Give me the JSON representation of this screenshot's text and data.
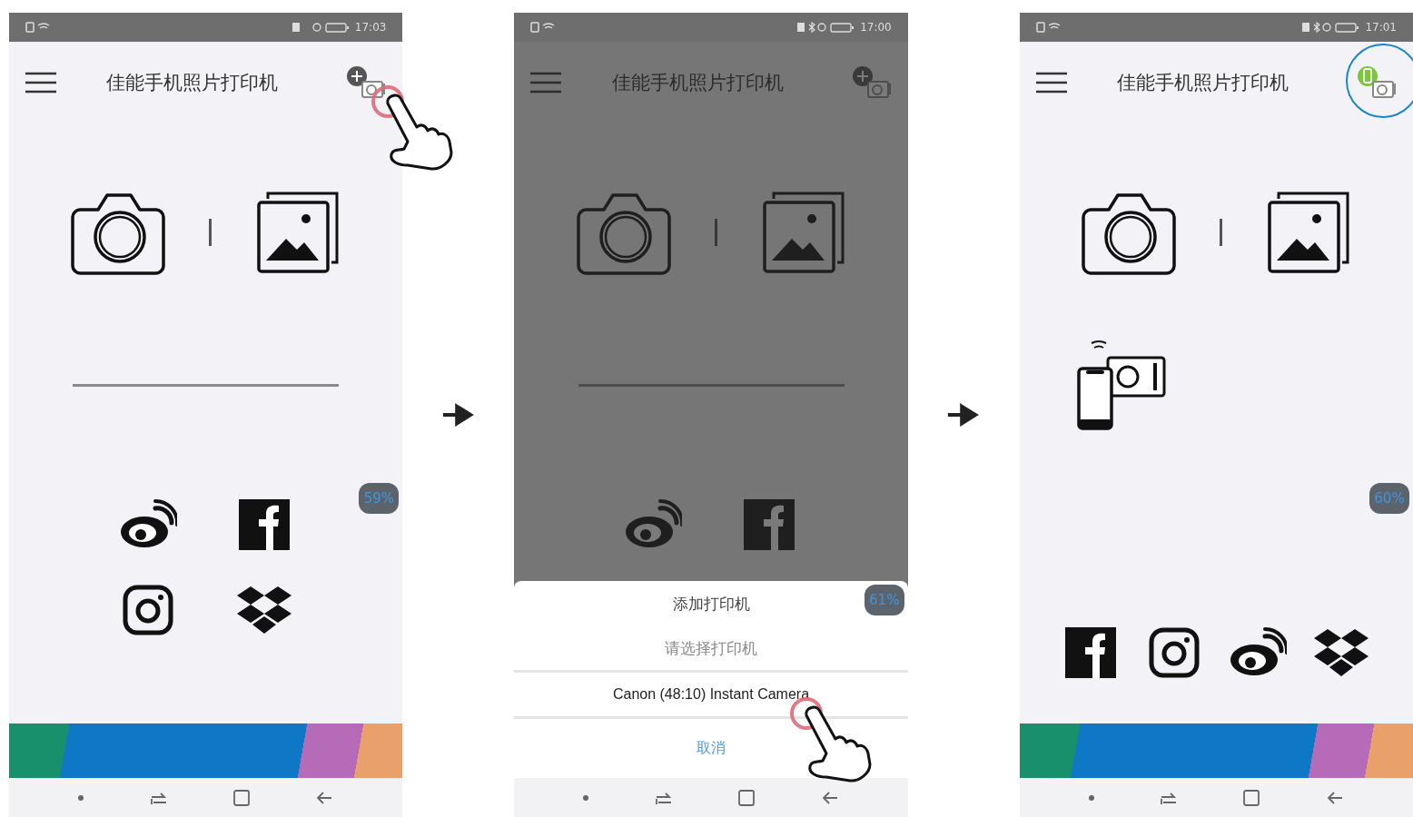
{
  "steps": [
    {
      "status_bar": {
        "time": "17:03",
        "bluetooth": false
      },
      "app_bar": {
        "title": "佳能手机照片打印机",
        "printer_connected": false,
        "tap_hand": true,
        "highlight_ring": false
      },
      "home": {
        "printer_added": false,
        "share_icons": [
          {
            "kind": "weibo"
          },
          {
            "kind": "facebook"
          },
          {
            "kind": "instagram"
          },
          {
            "kind": "dropbox"
          }
        ]
      },
      "memory_badge": "59%",
      "dimmed": false
    },
    {
      "status_bar": {
        "time": "17:00",
        "bluetooth": true
      },
      "app_bar": {
        "title": "佳能手机照片打印机",
        "printer_connected": false,
        "tap_hand": false,
        "highlight_ring": false
      },
      "home": {
        "printer_added": false,
        "share_icons": [
          {
            "kind": "weibo"
          },
          {
            "kind": "facebook"
          }
        ]
      },
      "memory_badge": "61%",
      "dimmed": true,
      "dialog": {
        "title": "添加打印机",
        "subtitle": "请选择打印机",
        "options": [
          {
            "label": "Canon (48:10) Instant Camera",
            "tapped": true
          }
        ],
        "cancel": "取消"
      }
    },
    {
      "status_bar": {
        "time": "17:01",
        "bluetooth": true
      },
      "app_bar": {
        "title": "佳能手机照片打印机",
        "printer_connected": true,
        "tap_hand": false,
        "highlight_ring": true
      },
      "home": {
        "printer_added": true,
        "share_icons": [
          {
            "kind": "facebook"
          },
          {
            "kind": "instagram"
          },
          {
            "kind": "weibo"
          },
          {
            "kind": "dropbox"
          }
        ]
      },
      "memory_badge": "60%",
      "dimmed": false
    }
  ]
}
